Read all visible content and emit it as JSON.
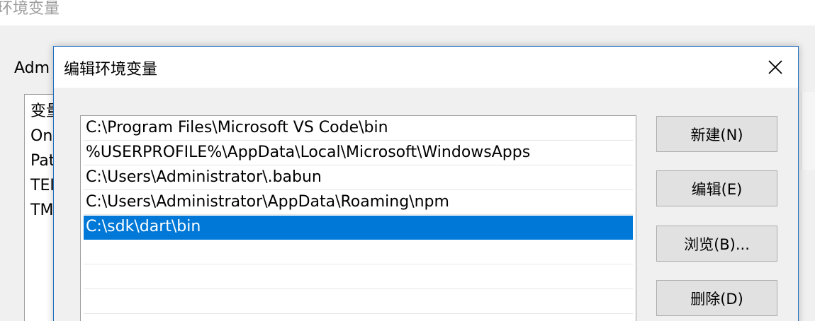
{
  "parent_window": {
    "title": "环境变量",
    "group_label": "Adm",
    "list_items": [
      "变量",
      "On",
      "Pat",
      "TEI",
      "TM"
    ]
  },
  "dialog": {
    "title": "编辑环境变量",
    "close_icon": "close-icon",
    "paths": [
      "C:\\Program Files\\Microsoft VS Code\\bin",
      "%USERPROFILE%\\AppData\\Local\\Microsoft\\WindowsApps",
      "C:\\Users\\Administrator\\.babun",
      "C:\\Users\\Administrator\\AppData\\Roaming\\npm",
      "C:\\sdk\\dart\\bin",
      "",
      "",
      ""
    ],
    "selected_index": 4,
    "buttons": {
      "new": "新建(N)",
      "edit": "编辑(E)",
      "browse": "浏览(B)...",
      "delete": "删除(D)"
    }
  },
  "colors": {
    "selection": "#0078d7",
    "dialog_border": "#1f6fc4"
  }
}
